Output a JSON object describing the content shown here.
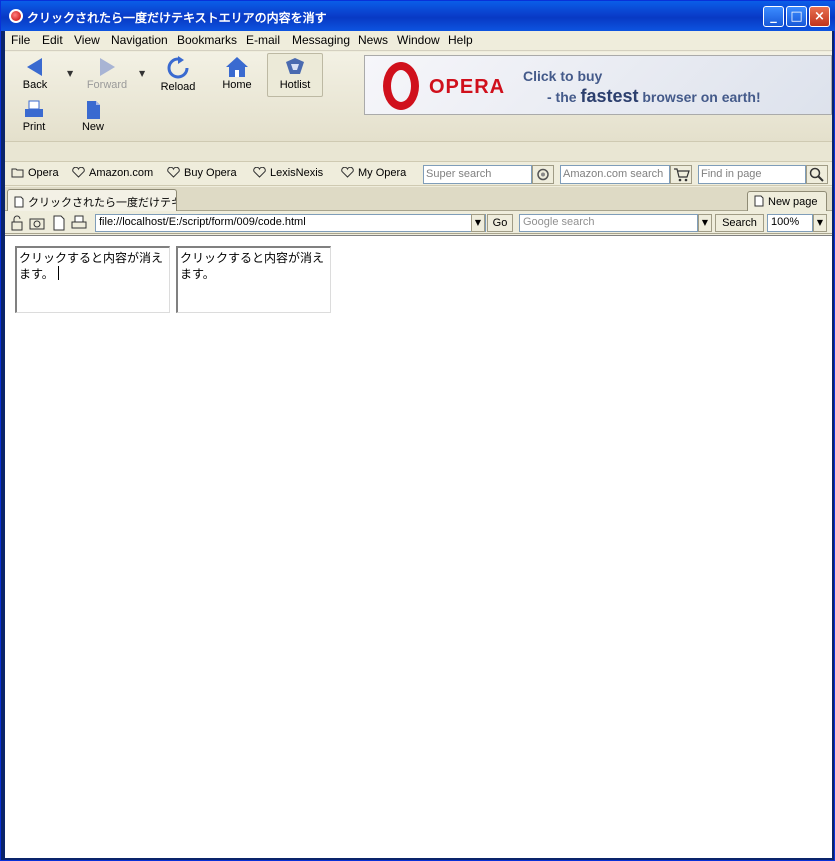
{
  "window": {
    "title": "クリックされたら一度だけテキストエリアの内容を消す",
    "controls": {
      "minimize": "_",
      "maximize": "□",
      "close": "×"
    }
  },
  "menubar": {
    "items": [
      {
        "label": "File"
      },
      {
        "label": "Edit"
      },
      {
        "label": "View"
      },
      {
        "label": "Navigation"
      },
      {
        "label": "Bookmarks"
      },
      {
        "label": "E-mail"
      },
      {
        "label": "Messaging"
      },
      {
        "label": "News"
      },
      {
        "label": "Window"
      },
      {
        "label": "Help"
      }
    ]
  },
  "toolbar": {
    "back_label": "Back",
    "forward_label": "Forward",
    "reload_label": "Reload",
    "home_label": "Home",
    "hotlist_label": "Hotlist",
    "print_label": "Print",
    "new_label": "New"
  },
  "banner": {
    "brand": "OPERA",
    "line1": "Click to buy",
    "line2_prefix": "- the ",
    "line2_emphasis": "fastest",
    "line2_suffix": " browser on earth!",
    "brand_color": "#d0101c"
  },
  "personalbar": {
    "items": [
      {
        "label": "Opera",
        "icon": "folder-icon"
      },
      {
        "label": "Amazon.com",
        "icon": "heart-icon"
      },
      {
        "label": "Buy Opera",
        "icon": "heart-icon"
      },
      {
        "label": "LexisNexis",
        "icon": "heart-icon"
      },
      {
        "label": "My Opera",
        "icon": "heart-icon"
      }
    ],
    "super_search_placeholder": "Super search",
    "amazon_search_placeholder": "Amazon.com search",
    "find_in_page_placeholder": "Find in page"
  },
  "tabs": {
    "active_label": "クリックされたら一度だけテキス...",
    "new_page_label": "New page"
  },
  "navbar": {
    "address": "file://localhost/E:/script/form/009/code.html",
    "go_label": "Go",
    "google_placeholder": "Google search",
    "search_label": "Search",
    "zoom": "100%"
  },
  "content": {
    "textarea1": "クリックすると内容が消えます。",
    "textarea2": "クリックすると内容が消えます。"
  }
}
